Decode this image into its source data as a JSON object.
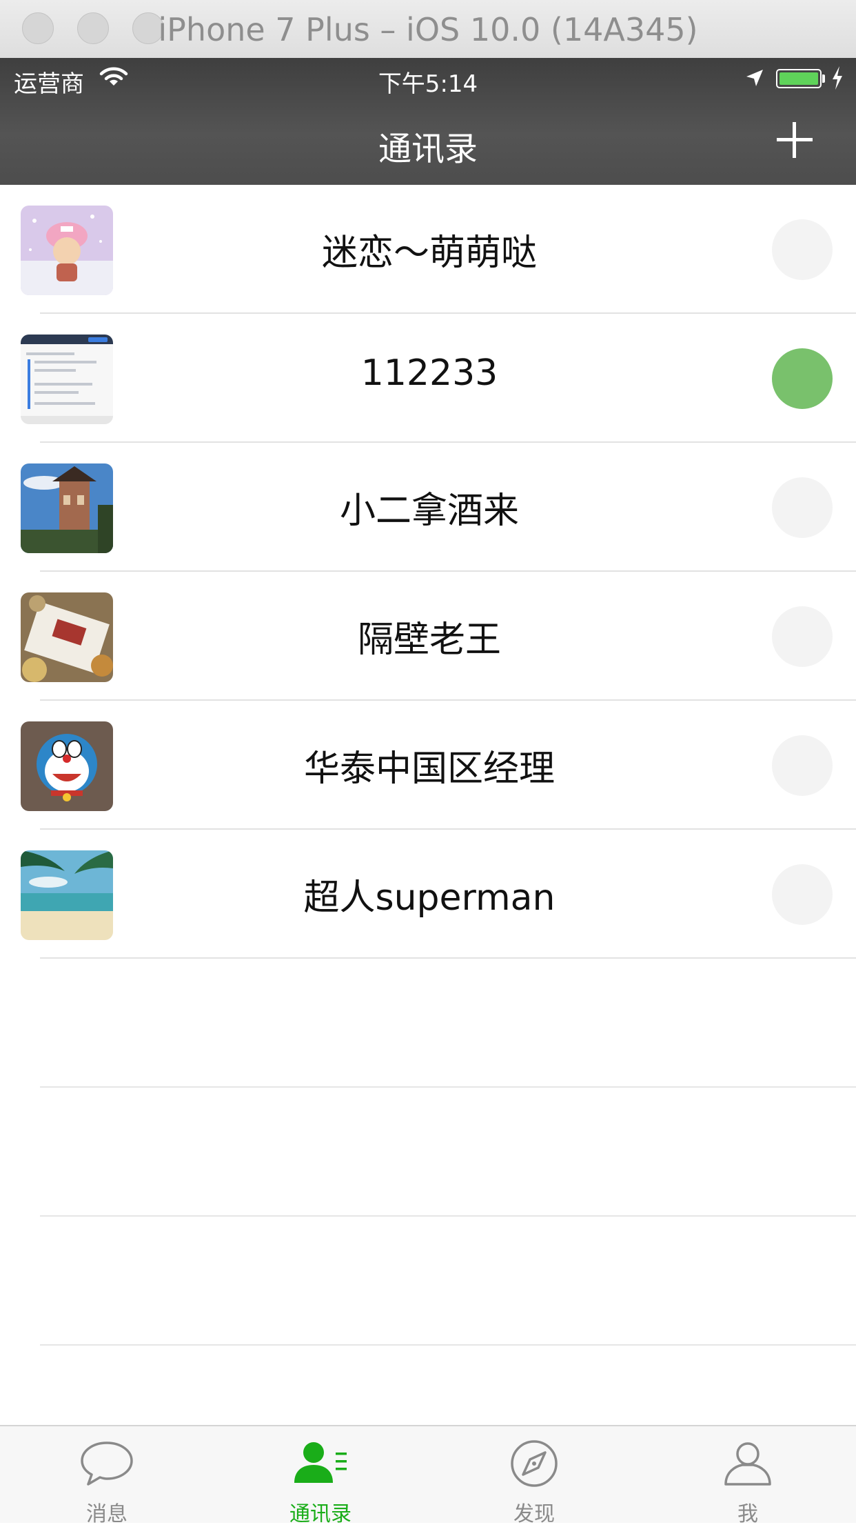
{
  "window": {
    "title": "iPhone 7 Plus – iOS 10.0 (14A345)"
  },
  "status_bar": {
    "carrier": "运营商",
    "time": "下午5:14",
    "battery_percent": 100,
    "battery_color": "#5fd35a"
  },
  "nav": {
    "title": "通讯录"
  },
  "contacts": [
    {
      "name": "迷恋～萌萌哒",
      "online": false
    },
    {
      "name": "112233",
      "online": true
    },
    {
      "name": "小二拿酒来",
      "online": false
    },
    {
      "name": "隔壁老王",
      "online": false
    },
    {
      "name": "华泰中国区经理",
      "online": false
    },
    {
      "name": "超人superman",
      "online": false
    }
  ],
  "colors": {
    "nav_bg": "#4d4d4d",
    "online": "#79c16c",
    "offline": "#f3f3f3",
    "tab_active": "#1aad19",
    "tab_inactive": "#8a8a8a"
  },
  "tabs": [
    {
      "label": "消息",
      "icon": "chat-bubble-icon",
      "active": false
    },
    {
      "label": "通讯录",
      "icon": "contacts-icon",
      "active": true
    },
    {
      "label": "发现",
      "icon": "compass-icon",
      "active": false
    },
    {
      "label": "我",
      "icon": "person-icon",
      "active": false
    }
  ]
}
